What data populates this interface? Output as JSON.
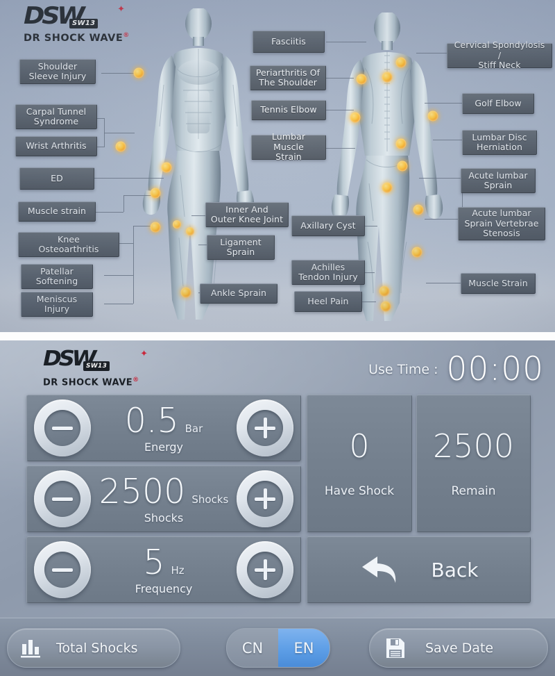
{
  "brand": {
    "mark": "DSW",
    "badge": "SW13",
    "tagline": "DR SHOCK WAVE",
    "star": "✦",
    "registered": "®",
    "accent_red": "#c9273b",
    "logo_dark": "#1b2026"
  },
  "anatomy": {
    "marker_color": "#ffc233",
    "front_view_labels": [
      {
        "text": "Shoulder\nSleeve Injury"
      },
      {
        "text": "Carpal Tunnel\nSyndrome"
      },
      {
        "text": "Wrist Arthritis"
      },
      {
        "text": "ED"
      },
      {
        "text": "Muscle strain"
      },
      {
        "text": "Knee\nOsteoarthritis"
      },
      {
        "text": "Patellar\nSoftening"
      },
      {
        "text": "Meniscus\nInjury"
      },
      {
        "text": "Inner And\nOuter Knee Joint"
      },
      {
        "text": "Ligament\nSprain"
      },
      {
        "text": "Ankle Sprain"
      }
    ],
    "back_view_labels": [
      {
        "text": "Fasciitis"
      },
      {
        "text": "Periarthritis Of\nThe Shoulder"
      },
      {
        "text": "Tennis Elbow"
      },
      {
        "text": "Lumbar Muscle\nStrain"
      },
      {
        "text": "Axillary Cyst"
      },
      {
        "text": "Achilles\nTendon Injury"
      },
      {
        "text": "Heel Pain"
      },
      {
        "text": "Cervical Spondylosis /\nStiff Neck"
      },
      {
        "text": "Golf Elbow"
      },
      {
        "text": "Lumbar Disc\nHerniation"
      },
      {
        "text": "Acute lumbar\nSprain"
      },
      {
        "text": "Acute lumbar\nSprain Vertebrae\nStenosis"
      },
      {
        "text": "Muscle Strain"
      }
    ]
  },
  "machine": {
    "use_time": {
      "label": "Use Time :",
      "value": "00:00"
    },
    "controls": [
      {
        "id": "energy",
        "value": "0.5",
        "unit": "Bar",
        "caption": "Energy",
        "minus": "−",
        "plus": "+"
      },
      {
        "id": "shocks",
        "value": "2500",
        "unit": "Shocks",
        "caption": "Shocks",
        "minus": "−",
        "plus": "+"
      },
      {
        "id": "frequency",
        "value": "5",
        "unit": "Hz",
        "caption": "Frequency",
        "minus": "−",
        "plus": "+"
      }
    ],
    "stats": [
      {
        "id": "have-shock",
        "value": "0",
        "caption": "Have Shock"
      },
      {
        "id": "remain",
        "value": "2500",
        "caption": "Remain"
      }
    ],
    "back_button": {
      "label": "Back",
      "icon": "back-arrow-icon"
    },
    "toolbar": {
      "total_shocks": {
        "label": "Total Shocks",
        "icon": "bar-chart-icon"
      },
      "language": {
        "options": [
          "CN",
          "EN"
        ],
        "selected": "EN",
        "active_color": "#5d9ee6"
      },
      "save_date": {
        "label": "Save Date",
        "icon": "floppy-disk-icon"
      }
    }
  }
}
